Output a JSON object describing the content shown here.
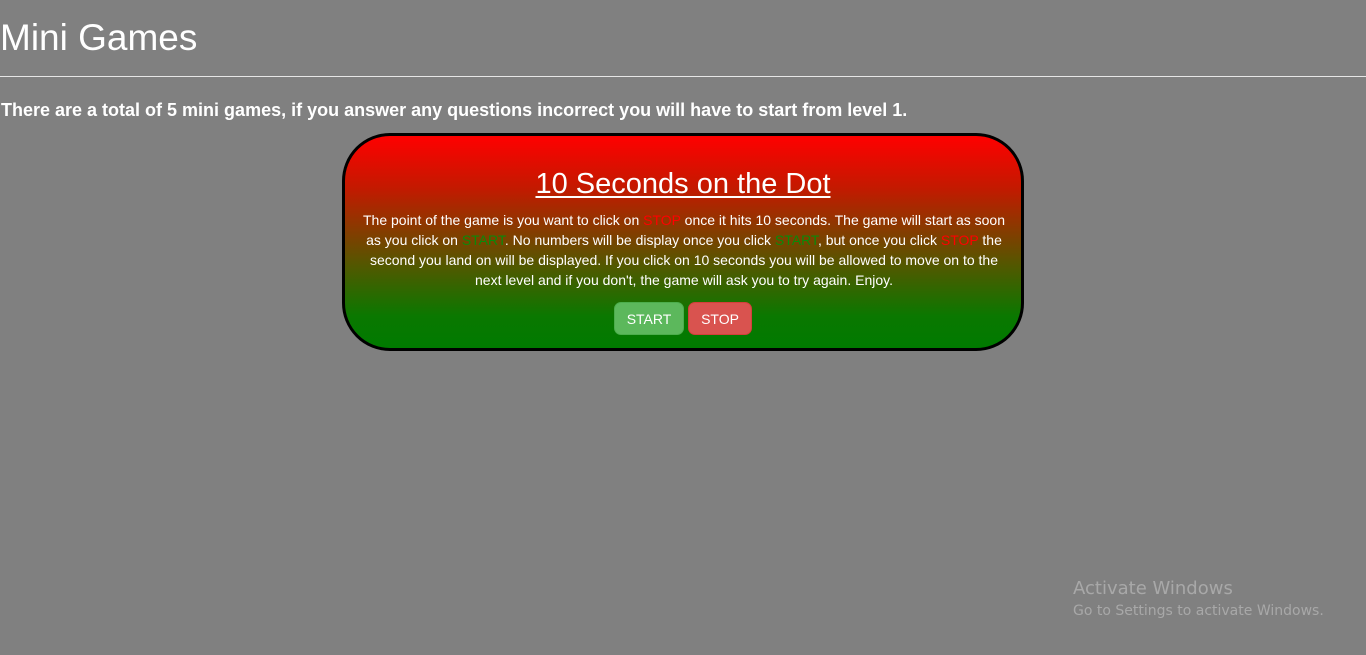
{
  "header": {
    "title": "Mini Games"
  },
  "intro": {
    "text": "There are a total of 5 mini games, if you answer any questions incorrect you will have to start from level 1."
  },
  "game": {
    "title": "10 Seconds on the Dot",
    "description": {
      "p1": "The point of the game is you want to click on ",
      "kw1": "STOP",
      "p2": " once it hits 10 seconds. The game will start as soon as you click on ",
      "kw2": "START",
      "p3": ". No numbers will be display once you click ",
      "kw3": "START",
      "p4": ", but once you click ",
      "kw4": "STOP",
      "p5": " the second you land on will be displayed. If you click on 10 seconds you will be allowed to move on to the next level and if you don't, the game will ask you to try again. Enjoy."
    },
    "buttons": {
      "start_label": "START",
      "stop_label": "STOP"
    },
    "colors": {
      "gradient_top": "#ff0000",
      "gradient_bottom": "#007a00",
      "stop_keyword": "#ff0000",
      "start_keyword": "#0a8a0a",
      "start_button": "#5cb85c",
      "stop_button": "#d9534f"
    }
  },
  "watermark": {
    "line1": "Activate Windows",
    "line2": "Go to Settings to activate Windows."
  },
  "page": {
    "background": "#808080"
  }
}
